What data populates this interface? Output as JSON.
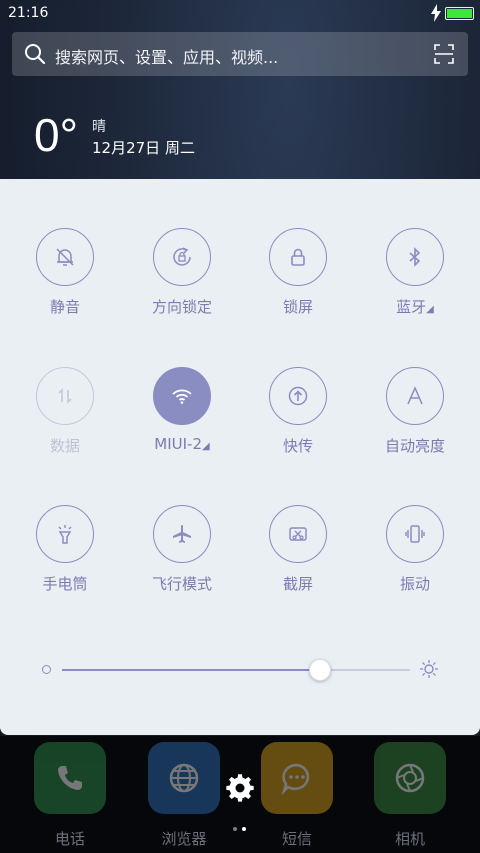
{
  "status_bar": {
    "time": "21:16",
    "battery_level": 1.0
  },
  "search": {
    "placeholder": "搜索网页、设置、应用、视频..."
  },
  "weather": {
    "temperature": "0°",
    "condition": "晴",
    "date": "12月27日 周二"
  },
  "quick_settings": {
    "tiles": [
      {
        "label": "静音",
        "icon": "mute-bell-icon",
        "state": "on"
      },
      {
        "label": "方向锁定",
        "icon": "rotation-lock-icon",
        "state": "on"
      },
      {
        "label": "锁屏",
        "icon": "lock-icon",
        "state": "on"
      },
      {
        "label": "蓝牙",
        "icon": "bluetooth-icon",
        "state": "on"
      },
      {
        "label": "数据",
        "icon": "mobile-data-icon",
        "state": "off"
      },
      {
        "label": "MIUI-2",
        "icon": "wifi-icon",
        "state": "active"
      },
      {
        "label": "快传",
        "icon": "quick-transfer-icon",
        "state": "on"
      },
      {
        "label": "自动亮度",
        "icon": "auto-brightness-icon",
        "state": "on"
      },
      {
        "label": "手电筒",
        "icon": "flashlight-icon",
        "state": "on"
      },
      {
        "label": "飞行模式",
        "icon": "airplane-icon",
        "state": "on"
      },
      {
        "label": "截屏",
        "icon": "screenshot-icon",
        "state": "on"
      },
      {
        "label": "振动",
        "icon": "vibrate-icon",
        "state": "on"
      }
    ],
    "brightness_level": 0.74
  },
  "dock": {
    "apps": [
      {
        "label": "电话",
        "icon": "phone-icon",
        "color": "#2f8f4a"
      },
      {
        "label": "浏览器",
        "icon": "globe-icon",
        "color": "#2f6fb8"
      },
      {
        "label": "短信",
        "icon": "message-icon",
        "color": "#d9a21a"
      },
      {
        "label": "相机",
        "icon": "camera-icon",
        "color": "#3a8a3e"
      }
    ]
  },
  "colors": {
    "accent": "#8a8dc2",
    "panel_bg": "#e9eff3"
  }
}
